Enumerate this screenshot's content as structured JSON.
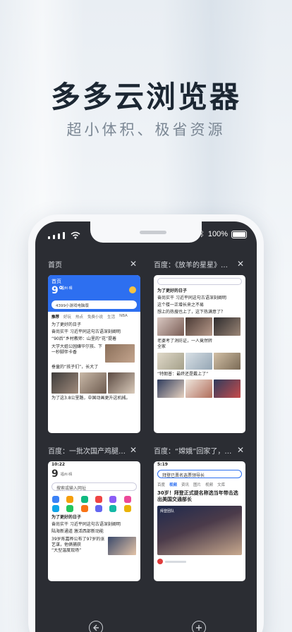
{
  "hero": {
    "title": "多多云浏览器",
    "subtitle": "超小体积、极省资源"
  },
  "status_bar": {
    "battery": "100%",
    "bluetooth_icon": "bluetooth-icon"
  },
  "tabs": [
    {
      "title": "首页",
      "close": "✕",
      "home_label": "首页",
      "temperature": "9°",
      "city": "福州·晴",
      "search_text": "4399小游戏电脑版",
      "feed_tabs": [
        "推荐",
        "好玩",
        "热点",
        "免费小说",
        "生活",
        "NBA"
      ],
      "items": [
        "为了更好的日子",
        "奋尚实干 习近平同这句古语深刻阐明",
        "“90后”乡村教师：山里的“花”提着",
        "大学大姐公园嫌华尔孩、下一秒脚伴卡香",
        "垂童的“孩子们”，长大了",
        "为了这3.8公里路，中国动画更升这机械。"
      ]
    },
    {
      "title": "百度：《放羊的星星》翻拍...",
      "close": "✕",
      "items": [
        "为了更好的日子",
        "奋尚实干 习近平同这句古语深刻阐明",
        "这个楼一正增长来之不易",
        "想上的热搜也上了，这下热满意了？",
        "老婆考了消防证，一人竟然转全家",
        "“特朗普：最终还是戴上了”"
      ]
    },
    {
      "title": "百度：一批次国产鸡腿外包...",
      "close": "✕",
      "time": "10:22",
      "temperature": "9",
      "city": "福州·晴",
      "search_placeholder": "搜索或输入网址",
      "items": [
        "为了更好的日子",
        "奋尚实干 习近平同这句古语深刻阐明",
        "陆海新通道 激活西部新动能",
        "39岁陈嘉桦公布了97岁的张艺谋，他俩捕获",
        "“大型温度现场”"
      ]
    },
    {
      "title": "百度：“嫦娥”回家了，还带...",
      "close": "✕",
      "time": "5:19",
      "search_text": "拜登已晋名选票领导长",
      "feed_tabs": [
        "百度",
        "视频",
        "资讯",
        "图片",
        "视频",
        "文库"
      ],
      "items": [
        "30岁！拜登正式提名称选当年带击选出美国交通部长",
        "拜登团队"
      ]
    }
  ],
  "toolbar": {
    "back_icon": "back-icon",
    "new_tab_icon": "add-icon"
  },
  "colors": {
    "accent": "#2d6ff0",
    "screen_bg": "#2b2d33"
  }
}
